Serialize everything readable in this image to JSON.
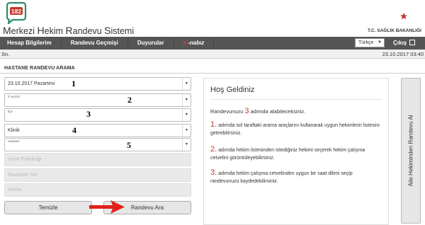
{
  "header": {
    "logo_number": "182",
    "brand_parts": [
      {
        "cap": "M",
        "rest": "erkezi "
      },
      {
        "cap": "H",
        "rest": "ekim "
      },
      {
        "cap": "R",
        "rest": "andevu "
      },
      {
        "cap": "S",
        "rest": "istemi"
      }
    ],
    "ministry": "T.C. SAĞLIK BAKANLIĞI"
  },
  "nav": {
    "items": [
      "Hesap Bilgilerim",
      "Randevu Geçmişi",
      "Duyurular"
    ],
    "nabiz_mark": "e",
    "nabiz_text": "-nabız",
    "language": "Türkçe",
    "logout": "Çıkış"
  },
  "status": {
    "left": "Sn.",
    "time": "23.10.2017 03:40"
  },
  "form": {
    "title": "HASTANE RANDEVU ARAMA",
    "date": "23.10.2017 Pazartesi",
    "il_label": "İl seçiniz",
    "ilce_label": "İlçe",
    "klinik": "Klinik",
    "hastane_label": "Hastane",
    "semt": "Semt Polikliniği",
    "muayene": "Muayene Yeri",
    "hekim": "Hekim",
    "clear_button": "Temizle",
    "search_button": "Randevu Ara",
    "numbers": [
      "1",
      "2",
      "3",
      "4",
      "5"
    ]
  },
  "welcome": {
    "title": "Hoş Geldiniz",
    "intro_before": "Randevunuzu",
    "intro_num": "3",
    "intro_after": "adımda alabileceksiniz.",
    "steps": [
      {
        "num": "1.",
        "text": "adımda sol taraftaki arama araçlarını kullanarak uygun hekimlerin listesini getirebilirsiniz."
      },
      {
        "num": "2.",
        "text": "adımda hekim listesinden istediğiniz hekimi seçerek hekim çalışma cetvelini görüntüleyebilirsiniz."
      },
      {
        "num": "3.",
        "text": "adımda hekim çalışma cetvelinden uygun bir saat dilimi seçip randevunuzu kaydedebilirsiniz."
      }
    ]
  },
  "side_button": "Aile Hekiminden Randevu Al",
  "colors": {
    "nav_bg": "#555555",
    "accent_red": "#c0392b",
    "logo_green": "#2e8b6e"
  }
}
